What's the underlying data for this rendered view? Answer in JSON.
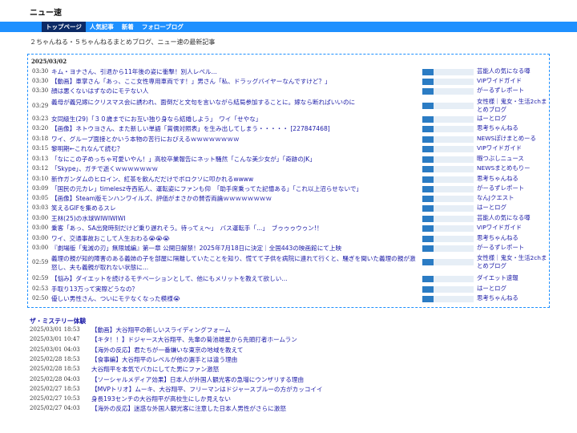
{
  "site": {
    "title": "ニュー速"
  },
  "nav": [
    {
      "label": "トップページ",
      "active": true
    },
    {
      "label": "人気記事",
      "active": false
    },
    {
      "label": "新着",
      "active": false
    },
    {
      "label": "フォローブログ",
      "active": false
    }
  ],
  "tagline": "２ちゃんねる・５ちゃんねるまとめブログ、ニュー速の最新記事",
  "feed": {
    "date": "2025/03/02",
    "items": [
      {
        "time": "03:30",
        "title": "キム・ヨナさん、引退から11年後の姿に衝撃！別人レベル...",
        "level": 0.22,
        "source": "芸能人の気になる噂"
      },
      {
        "time": "03:30",
        "title": "【動画】車掌さん「あっ、ここ女性専用車両です！」男さん「私、ドラッグバイヤーなんですけど？」",
        "level": 0.22,
        "source": "VIPワイドガイド"
      },
      {
        "time": "03:30",
        "title": "顔は悪くないはずなのにモテない人",
        "level": 0.22,
        "source": "がーるずレポート"
      },
      {
        "time": "03:29",
        "title": "義母が義兄嫁にクリスマス会に誘われ、面倒だと文句を言いながら結局参加することに。嫁なら断ればいいのに",
        "level": 0.22,
        "source": "女性様｜鬼女・生活2chまとめブログ"
      },
      {
        "time": "03:23",
        "title": "女同級生(29)「３０歳までにお互い独り身なら結婚しよう」　ワイ「せやな」",
        "level": 0.22,
        "source": "はーとログ"
      },
      {
        "time": "03:20",
        "title": "【画像】ネトウヨさん、また新しい単語「賞儒対照表」を生み出してしまう・・・・・ [227847468]",
        "level": 0.22,
        "source": "思考ちゃんねる"
      },
      {
        "time": "03:18",
        "title": "ワイ、グループ面接とかいう本物の苦行におびえるｗｗｗｗｗｗｗｗ",
        "level": 0.22,
        "source": "NEWSぽけまとめーる"
      },
      {
        "time": "03:15",
        "title": "黎明期←これなんて読む？",
        "level": 0.22,
        "source": "VIPワイドガイド"
      },
      {
        "time": "03:13",
        "title": "「なにこの子めっちゃ可愛いやん！」高校卒業報告にネット騒然「こんな美少女が」「奇跡のJK」",
        "level": 0.22,
        "source": "暇つぶしニュース"
      },
      {
        "time": "03:12",
        "title": "「Skype」、ガチで逝くｗｗｗｗｗｗｗ",
        "level": 0.22,
        "source": "NEWSまとめもりー"
      },
      {
        "time": "03:10",
        "title": "新作ガンダムのヒロイン、紅茶を飲んだだけでボロクソに叩かれるwwww",
        "level": 0.22,
        "source": "思考ちゃんねる"
      },
      {
        "time": "03:09",
        "title": "「国民の元カレ」timelesz寺西拓人、運転姿にファンも仰　「助手席乗ってた記憶ある」「これ以上沼らせないで」",
        "level": 0.22,
        "source": "がーるずレポート"
      },
      {
        "time": "03:05",
        "title": "【画像】Steam版モンハンワイルズ、評価がまさかの賛否両論ｗｗｗｗｗｗｗｗ",
        "level": 0.22,
        "source": "なんJクエスト"
      },
      {
        "time": "03:03",
        "title": "笑えるGIFを集めるスレ",
        "level": 0.22,
        "source": "はーとログ"
      },
      {
        "time": "03:00",
        "title": "王林(25)の水球WIWIWIWI",
        "level": 0.22,
        "source": "芸能人の気になる噂"
      },
      {
        "time": "03:00",
        "title": "乗客「あっ、SA出発時刻だけど乗り遅れそう。待ってぇ〜」　バス運転手「...」　ブゥゥゥウゥン!！",
        "level": 0.22,
        "source": "VIPワイドガイド"
      },
      {
        "time": "03:00",
        "title": "ワイ、交通事故おこして人生おわる😭😭😭",
        "level": 0.22,
        "source": "思考ちゃんねる"
      },
      {
        "time": "03:00",
        "title": "『劇場版「鬼滅の刃」無限城編』第一章 公開日解禁！2025年7月18日に決定｜全国443の映画館にて上映",
        "level": 0.22,
        "source": "がーるずレポート"
      },
      {
        "time": "02:59",
        "title": "義理の親が知的障害のある義姉の子を部屋に隔離していたことを知り、慌てて子供を病院に連れて行くと、騒ぎを聞いた義理の親が激怒し、夫も義親が取れない状態に...",
        "level": 0.22,
        "source": "女性様｜鬼女・生活2chまとめブログ"
      },
      {
        "time": "02:59",
        "title": "【悩み】ダイエットを続けるモチベーションとして、他にもメリットを教えて欲しい...",
        "level": 0.22,
        "source": "ダイエット速報"
      },
      {
        "time": "02:53",
        "title": "手取り13万って実際どうなの？",
        "level": 0.22,
        "source": "はーとログ"
      },
      {
        "time": "02:50",
        "title": "優しい男性さん、ついにモテなくなった模様😭",
        "level": 0.22,
        "source": "思考ちゃんねる"
      }
    ]
  },
  "mystery": {
    "heading": "ザ・ミステリー体験",
    "items": [
      {
        "time": "2025/03/01 18:53",
        "title": "【動画】大谷翔平の新しいスライディングフォーム"
      },
      {
        "time": "2025/03/01 10:47",
        "title": "【キタ！！】ドジャース大谷翔平、先輩の菊池雄星から先頭打者ホームラン"
      },
      {
        "time": "2025/03/01 04:03",
        "title": "【海外の反応】君たちが一番嫌いな東京の地域を教えて"
      },
      {
        "time": "2025/02/28 18:53",
        "title": "【食事編】大谷翔平のレベルが他の選手とは違う理由"
      },
      {
        "time": "2025/02/28 18:53",
        "title": "大谷翔平を本気でバカにしてた男にファン激怒"
      },
      {
        "time": "2025/02/28 04:03",
        "title": "【ソーシャルメディア効果】日本人が外国人観光客の急増にウンザリする理由"
      },
      {
        "time": "2025/02/27 18:53",
        "title": "【MVPトリオ】ムーキ、大谷翔平、フリーマンはドジャースブルーの方がカッコイイ"
      },
      {
        "time": "2025/02/27 10:53",
        "title": "身長193センチの大谷翔平が高校生にしか見えない"
      },
      {
        "time": "2025/02/27 04:03",
        "title": "【海外の反応】迷惑な外国人観光客に注意した日本人男性がさらに激怒"
      }
    ]
  },
  "colors": {
    "accent": "#1e90ff",
    "nav_active": "#0b2a66",
    "link": "#1a1aa6",
    "bar": "#2b7cc4"
  }
}
